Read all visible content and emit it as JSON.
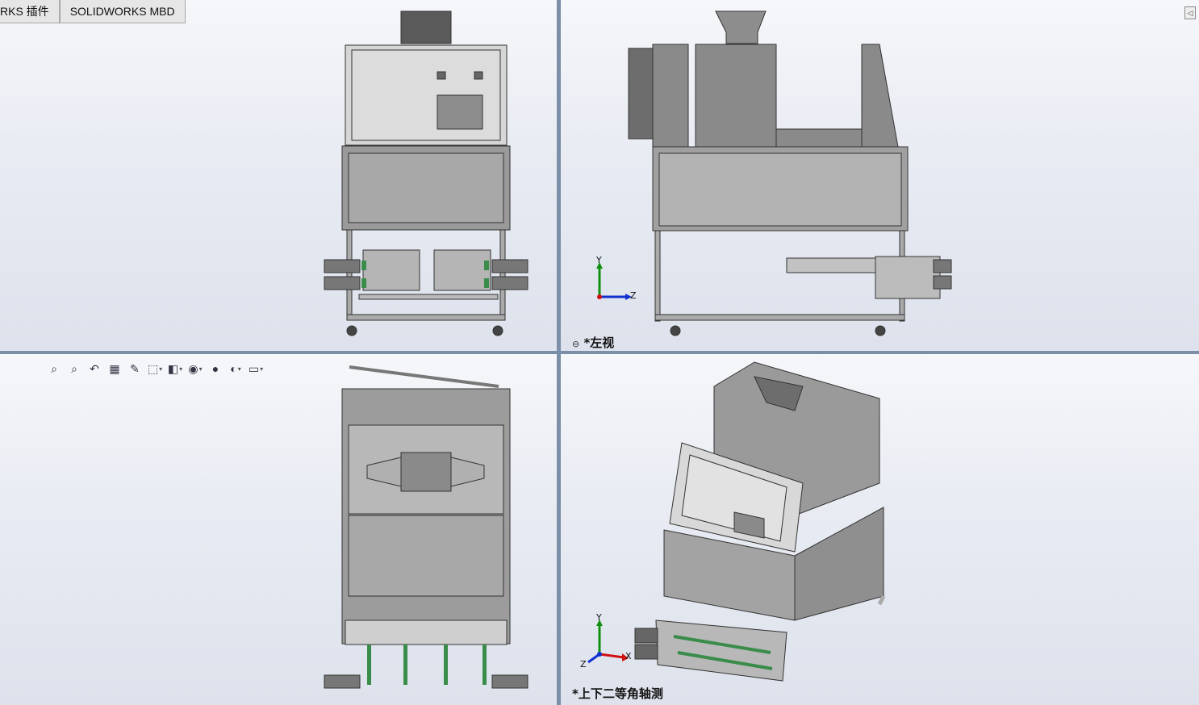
{
  "tabs": [
    {
      "label": "RKS 插件"
    },
    {
      "label": "SOLIDWORKS MBD"
    }
  ],
  "viewports": {
    "top_right": {
      "view_label": "*左视",
      "axis_y": "Y",
      "axis_z": "Z"
    },
    "bottom_right": {
      "view_label": "*上下二等角轴测",
      "axis_y": "Y",
      "axis_x": "X",
      "axis_z": "Z"
    }
  },
  "heads_up_toolbar": [
    {
      "icon": "zoom-to-fit-icon"
    },
    {
      "icon": "zoom-to-area-icon"
    },
    {
      "icon": "previous-view-icon"
    },
    {
      "icon": "section-view-icon"
    },
    {
      "icon": "dynamic-annotation-icon"
    },
    {
      "icon": "view-orientation-icon"
    },
    {
      "icon": "display-style-icon"
    },
    {
      "icon": "hide-show-items-icon"
    },
    {
      "icon": "edit-appearance-icon"
    },
    {
      "icon": "apply-scene-icon"
    },
    {
      "icon": "view-settings-icon"
    }
  ],
  "colors": {
    "viewport_border": "#7b8fa8",
    "model_gray": "#8a8a8a",
    "panel_light": "#d9d9d9",
    "accent_green": "#3a8c4a",
    "axis_red": "#d01010",
    "axis_green": "#109010",
    "axis_blue": "#1030d0"
  }
}
